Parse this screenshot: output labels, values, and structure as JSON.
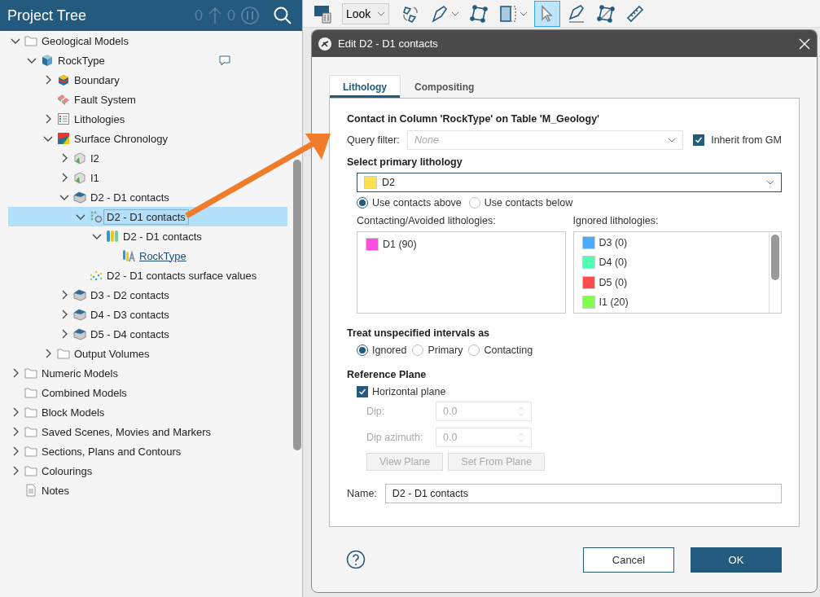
{
  "tree_panel": {
    "title": "Project Tree",
    "counters": [
      {
        "value": "0",
        "kind": "up"
      },
      {
        "value": "0",
        "kind": "pause"
      }
    ],
    "tree": [
      {
        "label": "Geological Models",
        "kind": "folder",
        "expanded": true,
        "selected": false,
        "children": [
          {
            "label": "RockType",
            "kind": "geomodel",
            "expanded": true,
            "selected": false,
            "comment": true,
            "children": [
              {
                "label": "Boundary",
                "kind": "boundary",
                "expanded": false,
                "selected": false
              },
              {
                "label": "Fault System",
                "kind": "fault",
                "selected": false
              },
              {
                "label": "Lithologies",
                "kind": "lithologies",
                "expanded": false,
                "selected": false
              },
              {
                "label": "Surface Chronology",
                "kind": "chronology",
                "expanded": true,
                "selected": false,
                "children": [
                  {
                    "label": "I2",
                    "kind": "intrusion",
                    "expanded": false,
                    "selected": false
                  },
                  {
                    "label": "I1",
                    "kind": "intrusion",
                    "expanded": false,
                    "selected": false
                  },
                  {
                    "label": "D2 - D1 contacts",
                    "kind": "deposit",
                    "expanded": true,
                    "selected": false,
                    "children": [
                      {
                        "label": "D2 - D1 contacts",
                        "kind": "contactset",
                        "expanded": true,
                        "selected": true,
                        "children": [
                          {
                            "label": "D2 - D1 contacts",
                            "kind": "column",
                            "expanded": true,
                            "selected": false,
                            "children": [
                              {
                                "label": "RockType",
                                "kind": "columnlink",
                                "link": true,
                                "selected": false
                              }
                            ]
                          }
                        ]
                      },
                      {
                        "label": "D2 - D1 contacts surface values",
                        "kind": "values",
                        "selected": false
                      }
                    ]
                  },
                  {
                    "label": "D3 - D2 contacts",
                    "kind": "deposit",
                    "expanded": false,
                    "selected": false
                  },
                  {
                    "label": "D4 - D3 contacts",
                    "kind": "deposit",
                    "expanded": false,
                    "selected": false
                  },
                  {
                    "label": "D5 - D4 contacts",
                    "kind": "deposit",
                    "expanded": false,
                    "selected": false
                  }
                ]
              },
              {
                "label": "Output Volumes",
                "kind": "folder",
                "expanded": false,
                "selected": false
              }
            ]
          }
        ]
      },
      {
        "label": "Numeric Models",
        "kind": "folder",
        "expanded": false,
        "selected": false
      },
      {
        "label": "Combined Models",
        "kind": "folder",
        "selected": false
      },
      {
        "label": "Block Models",
        "kind": "folder",
        "expanded": false,
        "selected": false
      },
      {
        "label": "Saved Scenes, Movies and Markers",
        "kind": "folder",
        "expanded": false,
        "selected": false
      },
      {
        "label": "Sections, Plans and Contours",
        "kind": "folder",
        "expanded": false,
        "selected": false
      },
      {
        "label": "Colourings",
        "kind": "folder",
        "expanded": false,
        "selected": false
      },
      {
        "label": "Notes",
        "kind": "note",
        "selected": false
      }
    ]
  },
  "toolbar": {
    "view_mode": "Look",
    "tools": [
      {
        "kind": "rotate",
        "selected": false,
        "dropdown": false
      },
      {
        "kind": "pen",
        "selected": false,
        "dropdown": true
      },
      {
        "kind": "polygon",
        "selected": false,
        "dropdown": false
      },
      {
        "kind": "slice",
        "selected": false,
        "dropdown": true
      },
      {
        "kind": "pointer",
        "selected": true,
        "dropdown": false
      },
      {
        "kind": "pen-line",
        "selected": false,
        "dropdown": false
      },
      {
        "kind": "polygon-cut",
        "selected": false,
        "dropdown": false
      },
      {
        "kind": "ruler",
        "selected": false,
        "dropdown": false
      }
    ]
  },
  "dialog": {
    "title": "Edit D2 - D1 contacts",
    "tabs": [
      {
        "label": "Lithology",
        "selected": true
      },
      {
        "label": "Compositing",
        "selected": false
      }
    ],
    "heading": "Contact in Column 'RockType' on Table 'M_Geology'",
    "query_filter": {
      "label": "Query filter:",
      "placeholder": "None",
      "disabled": true
    },
    "inherit": {
      "label": "Inherit from GM",
      "checked": true
    },
    "primary_heading": "Select primary lithology",
    "primary": {
      "value": "D2",
      "color": "#ffe14d"
    },
    "direction": [
      {
        "label": "Use contacts above",
        "selected": true
      },
      {
        "label": "Use contacts below",
        "selected": false
      }
    ],
    "contacting": {
      "label": "Contacting/Avoided lithologies:",
      "items": [
        {
          "label": "D1 (90)",
          "color": "#ff4de0"
        }
      ]
    },
    "ignored": {
      "label": "Ignored lithologies:",
      "items": [
        {
          "label": "D3 (0)",
          "color": "#4daaff"
        },
        {
          "label": "D4 (0)",
          "color": "#4dffb0"
        },
        {
          "label": "D5 (0)",
          "color": "#ff4d4d"
        },
        {
          "label": "I1 (20)",
          "color": "#80ff4d"
        }
      ]
    },
    "treat": {
      "heading": "Treat unspecified intervals as",
      "options": [
        {
          "label": "Ignored",
          "selected": true
        },
        {
          "label": "Primary",
          "selected": false
        },
        {
          "label": "Contacting",
          "selected": false
        }
      ]
    },
    "reference": {
      "heading": "Reference Plane",
      "horizontal": {
        "label": "Horizontal plane",
        "checked": true
      },
      "fields": [
        {
          "label": "Dip:",
          "value": "0.0",
          "disabled": true
        },
        {
          "label": "Dip azimuth:",
          "value": "0.0",
          "disabled": true
        }
      ],
      "buttons": [
        {
          "label": "View Plane",
          "disabled": true
        },
        {
          "label": "Set From Plane",
          "disabled": true
        }
      ]
    },
    "name": {
      "label": "Name:",
      "value": "D2 - D1 contacts"
    },
    "buttons": [
      {
        "label": "Cancel",
        "kind": "secondary"
      },
      {
        "label": "OK",
        "kind": "primary"
      }
    ]
  }
}
